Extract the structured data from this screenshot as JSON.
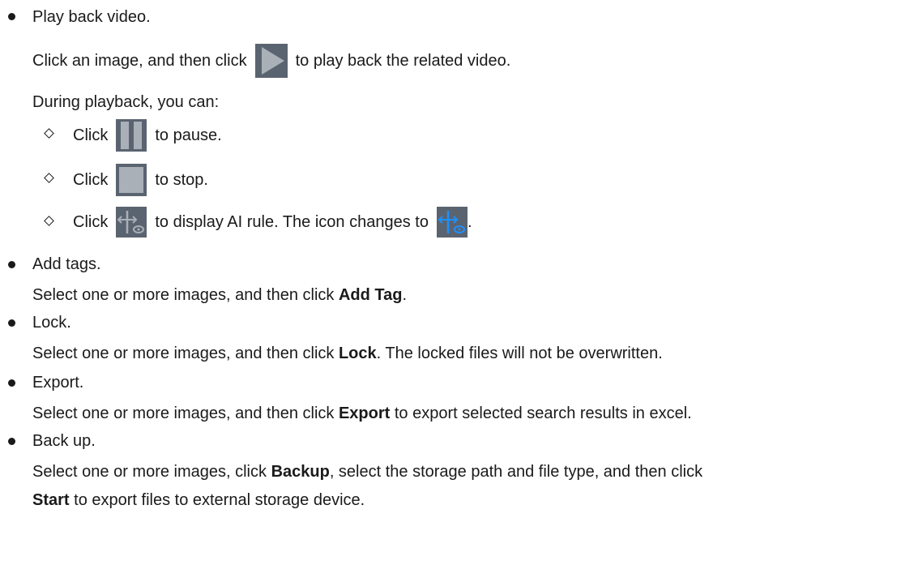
{
  "playback": {
    "heading": "Play back video.",
    "click_line_a": "Click an image, and then click",
    "click_line_b": "to play back the related video.",
    "during": "During playback, you can:",
    "pause_click": "Click",
    "pause_text": "to pause.",
    "stop_click": "Click",
    "stop_text": "to stop.",
    "ai_click": "Click",
    "ai_text": "to display AI rule. The icon changes to",
    "ai_end": "."
  },
  "tags": {
    "heading": "Add tags.",
    "line_a": "Select one or more images, and then click ",
    "bold": "Add Tag",
    "line_b": "."
  },
  "lock": {
    "heading": "Lock.",
    "line_a": "Select one or more images, and then click ",
    "bold": "Lock",
    "line_b": ". The locked files will not be overwritten."
  },
  "export": {
    "heading": "Export.",
    "line_a": "Select one or more images, and then click ",
    "bold": "Export",
    "line_b": " to export selected search results in excel."
  },
  "backup": {
    "heading": "Back up.",
    "line_a": "Select one or more images, click ",
    "bold_a": "Backup",
    "line_b": ", select the storage path and file type, and then click",
    "bold_b": "Start",
    "line_c": " to export files to external storage device."
  },
  "icons": {
    "play": "play-icon",
    "pause": "pause-icon",
    "stop": "stop-icon",
    "ai_rule": "ai-rule-icon",
    "ai_rule_active": "ai-rule-active-icon"
  },
  "colors": {
    "icon_bg": "#5a6470",
    "icon_fg": "#a9b0b8",
    "ai_active": "#1e90ff"
  }
}
